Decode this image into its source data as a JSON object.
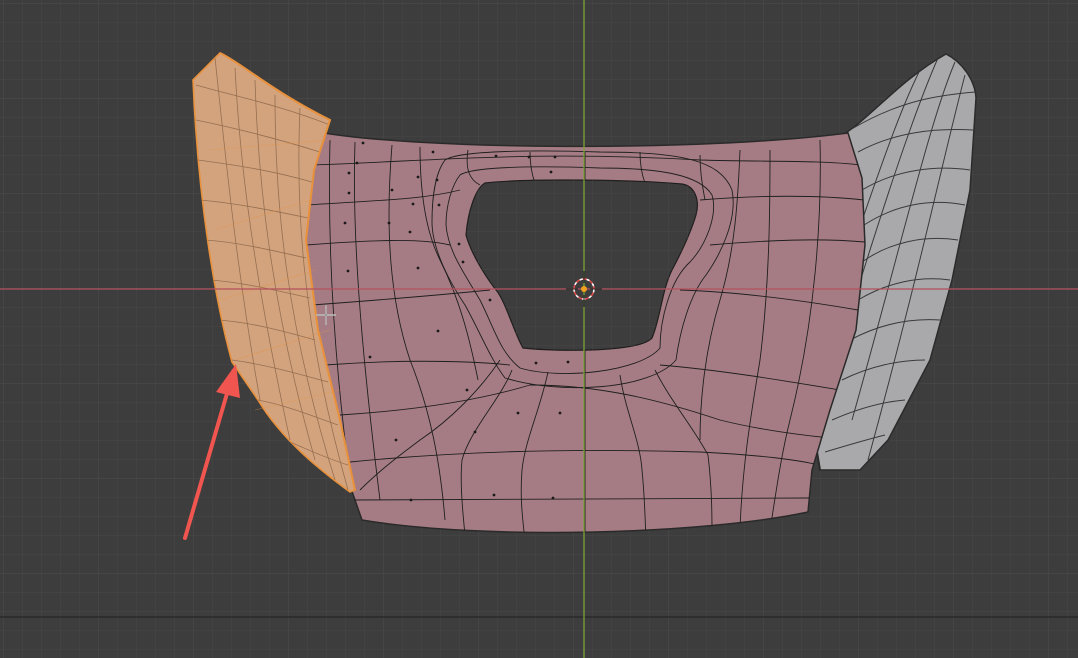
{
  "viewport": {
    "mode": "edit-mode",
    "view": "front-orthographic",
    "grid_visible": true,
    "colors": {
      "background": "#3d3d3d",
      "grid_minor": "#474747",
      "grid_major": "#505050",
      "axis_x": "#b34f5c",
      "axis_z": "#7da336",
      "selected_face_fill": "#d3a37e",
      "selected_edge": "#e8913c",
      "mesh_face_fill": "#a67c84",
      "mesh_edge": "#1e1e1e",
      "mesh_side_fill": "#a9a9ab",
      "annotation_arrow": "#f0554f"
    }
  },
  "mesh": {
    "object": "steering-wheel-shell",
    "selected_region": "left-side-faces",
    "has_center_hole": true
  },
  "overlays": {
    "cursor_icon": "crosshair",
    "origin_icon": "3d-cursor",
    "annotation": "red-arrow-pointing-at-selected-edge"
  }
}
